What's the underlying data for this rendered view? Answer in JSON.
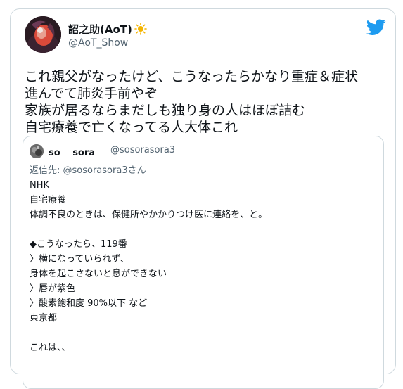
{
  "tweet": {
    "display_name": "詔之助(AoT)",
    "handle": "@AoT_Show",
    "text_lines": [
      "これ親父がなったけど、こうなったらかなり重症＆症状",
      "進んでて肺炎手前やぞ",
      "家族が居るならまだしも独り身の人はほぼ詰む",
      "自宅療養で亡くなってる人大体これ"
    ],
    "icons": {
      "avatar": "user-avatar",
      "sun": "sun-emoji-icon",
      "logo": "twitter-bird-icon"
    }
  },
  "quote": {
    "display_name": "so　 sora",
    "handle": "@sosorasora3",
    "reply_to": "返信先: @sosorasora3さん",
    "body_lines": [
      "NHK",
      "自宅療養",
      "体調不良のときは、保健所やかかりつけ医に連絡を、と。",
      "",
      "◆こうなったら、119番",
      "〉横になっていられず、",
      "身体を起こさないと息ができない",
      "〉唇が紫色",
      "〉酸素飽和度 90%以下 など",
      "東京都",
      "",
      "これは、、"
    ]
  },
  "colors": {
    "text": "#0f1419",
    "secondary": "#536471",
    "border": "#cfd9de",
    "twitter_blue": "#1d9bf0",
    "sun": "#f4b400"
  }
}
